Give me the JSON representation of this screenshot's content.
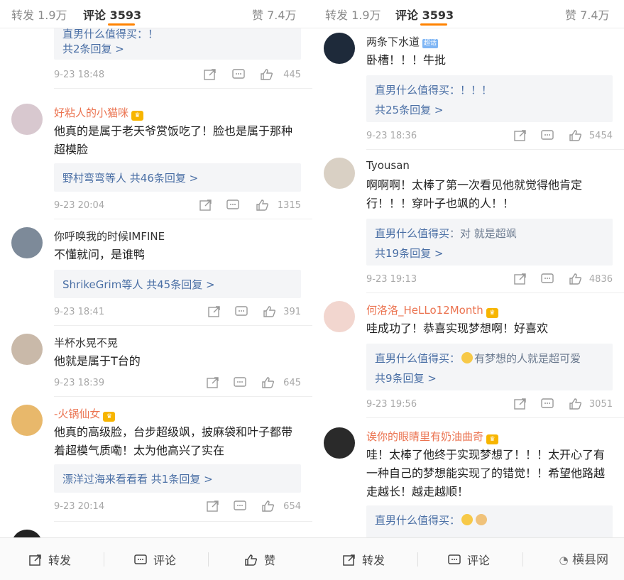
{
  "tabs": {
    "repost": "转发 1.9万",
    "comments": "评论 3593",
    "likes": "赞 7.4万"
  },
  "bottom": {
    "repost": "转发",
    "comment": "评论",
    "like": "赞",
    "watermark": "横县网"
  },
  "colors": {
    "accent": "#ff8200",
    "link": "#4a6fa5",
    "name_orange": "#eb7350"
  },
  "left": {
    "c0": {
      "reply1": "直男什么值得买：！",
      "reply2": "共2条回复 >",
      "time": "9-23 18:48",
      "likes": "445"
    },
    "c1": {
      "name": "好粘人的小猫咪",
      "text": "他真的是属于老天爷赏饭吃了！脸也是属于那种超模脸",
      "reply_who": "野村弯弯等人",
      "reply_count": "共46条回复 >",
      "time": "9-23 20:04",
      "likes": "1315"
    },
    "c2": {
      "name": "你呼唤我的时候IMFINE",
      "text": "不懂就问，是谁鸭",
      "reply_who": "ShrikeGrim等人",
      "reply_count": "共45条回复 >",
      "time": "9-23 18:41",
      "likes": "391"
    },
    "c3": {
      "name": "半杯水晃不晃",
      "text": "他就是属于T台的",
      "time": "9-23 18:39",
      "likes": "645"
    },
    "c4": {
      "name": "-火锅仙女",
      "text": "他真的高级脸，台步超级飒，披麻袋和叶子都带着超模气质嘞！太为他高兴了实在",
      "reply_who": "漂洋过海来看看看",
      "reply_count": "共1条回复 >",
      "time": "9-23 20:14",
      "likes": "654"
    }
  },
  "right": {
    "c0": {
      "name": "两条下水道",
      "badge": "超话",
      "text": "卧槽！！！牛批",
      "reply1": "直男什么值得买：！！！",
      "reply2": "共25条回复 >",
      "time": "9-23 18:36",
      "likes": "5454"
    },
    "c1": {
      "name": "Tyousan",
      "text": "啊啊啊！太棒了第一次看见他就觉得他肯定行！！！穿叶子也飒的人！！",
      "reply_author": "直男什么值得买",
      "reply_body": "：对 就是超飒",
      "reply2": "共19条回复 >",
      "time": "9-23 19:13",
      "likes": "4836"
    },
    "c2": {
      "name": "何洛洛_HeLLo12Month",
      "text": "哇成功了！恭喜实现梦想啊！好喜欢",
      "reply_author": "直男什么值得买",
      "reply_body": "有梦想的人就是超可爱",
      "reply2": "共9条回复 >",
      "time": "9-23 19:56",
      "likes": "3051"
    },
    "c3": {
      "name": "诶你的眼睛里有奶油曲奇",
      "text": "哇！太棒了他终于实现梦想了！！！太开心了有一种自己的梦想能实现了的错觉！！希望他路越走越长！越走越顺！",
      "reply_author": "直男什么值得买"
    }
  }
}
